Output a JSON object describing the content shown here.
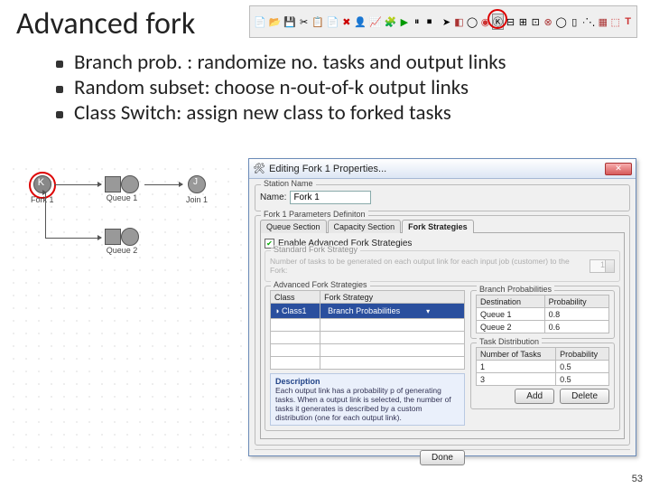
{
  "slide": {
    "title": "Advanced fork",
    "page_number": "53",
    "bullets": [
      "Branch prob. : randomize no. tasks and output links",
      "Random subset: choose n-out-of-k output links",
      "Class Switch: assign new class to forked tasks"
    ]
  },
  "canvas": {
    "fork": "Fork 1",
    "queue1": "Queue 1",
    "queue2": "Queue 2",
    "join": "Join 1"
  },
  "dialog": {
    "title": "Editing Fork 1 Properties...",
    "close": "✕",
    "station_name_group": "Station Name",
    "station_name_label": "Name:",
    "station_name_value": "Fork 1",
    "params_group": "Fork 1 Parameters Definiton",
    "tabs": {
      "queue": "Queue Section",
      "capacity": "Capacity Section",
      "strategies": "Fork Strategies"
    },
    "enable_adv_label": "Enable Advanced Fork Strategies",
    "standard_group": "Standard Fork Strategy",
    "standard_label": "Number of tasks to be generated on each output link for each input job (customer) to the Fork:",
    "standard_value": "1",
    "adv_group": "Advanced Fork Strategies",
    "cols": {
      "class": "Class",
      "strategy": "Fork Strategy"
    },
    "class1": "Class1",
    "strategy_value": "Branch Probabilities",
    "branch_group": "Branch Probabilities",
    "branch_cols": {
      "dest": "Destination",
      "prob": "Probability"
    },
    "branch_rows": [
      {
        "dest": "Queue 1",
        "prob": "0.8"
      },
      {
        "dest": "Queue 2",
        "prob": "0.6"
      }
    ],
    "task_group": "Task Distribution",
    "task_cols": {
      "n": "Number of Tasks",
      "prob": "Probability"
    },
    "task_rows": [
      {
        "n": "1",
        "prob": "0.5"
      },
      {
        "n": "3",
        "prob": "0.5"
      }
    ],
    "desc_hd": "Description",
    "desc_body": "Each output link has a probability p of generating tasks. When a output link is selected, the number of tasks it generates is described by a custom distribution (one for each output link).",
    "btn_add": "Add",
    "btn_delete": "Delete",
    "btn_done": "Done"
  }
}
